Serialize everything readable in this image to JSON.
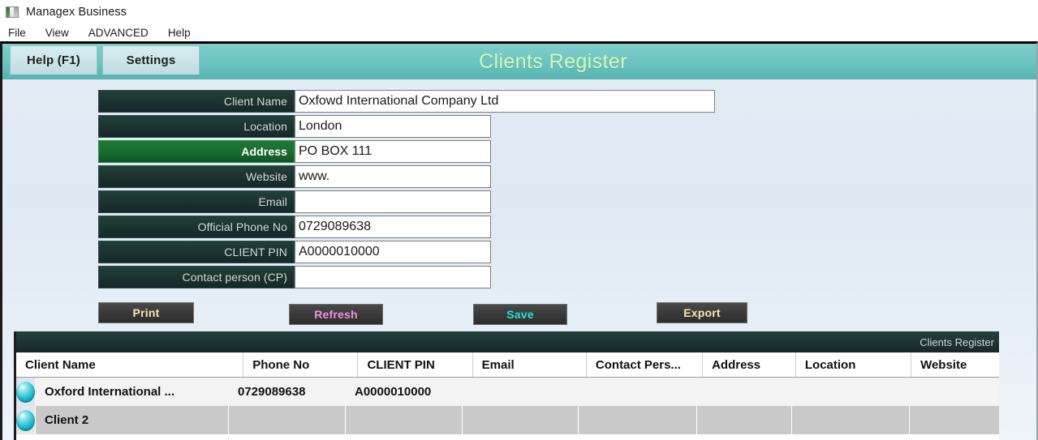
{
  "window": {
    "title": "Managex Business",
    "icon": "app-logo-icon"
  },
  "menubar": {
    "items": [
      {
        "label": "File"
      },
      {
        "label": "View"
      },
      {
        "label": "ADVANCED"
      },
      {
        "label": "Help"
      }
    ]
  },
  "header": {
    "tabs": [
      {
        "label": "Help (F1)"
      },
      {
        "label": "Settings"
      }
    ],
    "title": "Clients Register",
    "title_color": "#d6f7b8",
    "bar_color": "#6cc3c1"
  },
  "form": {
    "fields": [
      {
        "label": "Client Name",
        "value": "Oxfowd International Company Ltd",
        "highlighted": false
      },
      {
        "label": "Location",
        "value": "London",
        "highlighted": false
      },
      {
        "label": "Address",
        "value": "PO BOX 111",
        "highlighted": true
      },
      {
        "label": "Website",
        "value": "www.",
        "highlighted": false
      },
      {
        "label": "Email",
        "value": "",
        "highlighted": false
      },
      {
        "label": "Official Phone No",
        "value": "0729089638",
        "highlighted": false
      },
      {
        "label": "CLIENT PIN",
        "value": "A0000010000",
        "highlighted": false
      },
      {
        "label": "Contact person (CP)",
        "value": "",
        "highlighted": false
      }
    ]
  },
  "buttons": {
    "print": {
      "label": "Print",
      "color": "#f4e6b0"
    },
    "refresh": {
      "label": "Refresh",
      "color": "#f28fe0"
    },
    "save": {
      "label": "Save",
      "color": "#25e0e0"
    },
    "export": {
      "label": "Export",
      "color": "#f4e6b0"
    }
  },
  "grid": {
    "caption": "Clients Register",
    "columns": [
      "Client Name",
      "Phone No",
      "CLIENT PIN",
      "Email",
      "Contact Pers...",
      "Address",
      "Location",
      "Website"
    ],
    "rows": [
      {
        "marker": "status-sphere-icon",
        "cells": [
          "Oxford International ...",
          "0729089638",
          "A0000010000",
          "",
          "",
          "",
          "",
          ""
        ]
      },
      {
        "marker": "status-sphere-icon",
        "cells": [
          "Client 2",
          "",
          "",
          "",
          "",
          "",
          "",
          ""
        ]
      }
    ]
  }
}
